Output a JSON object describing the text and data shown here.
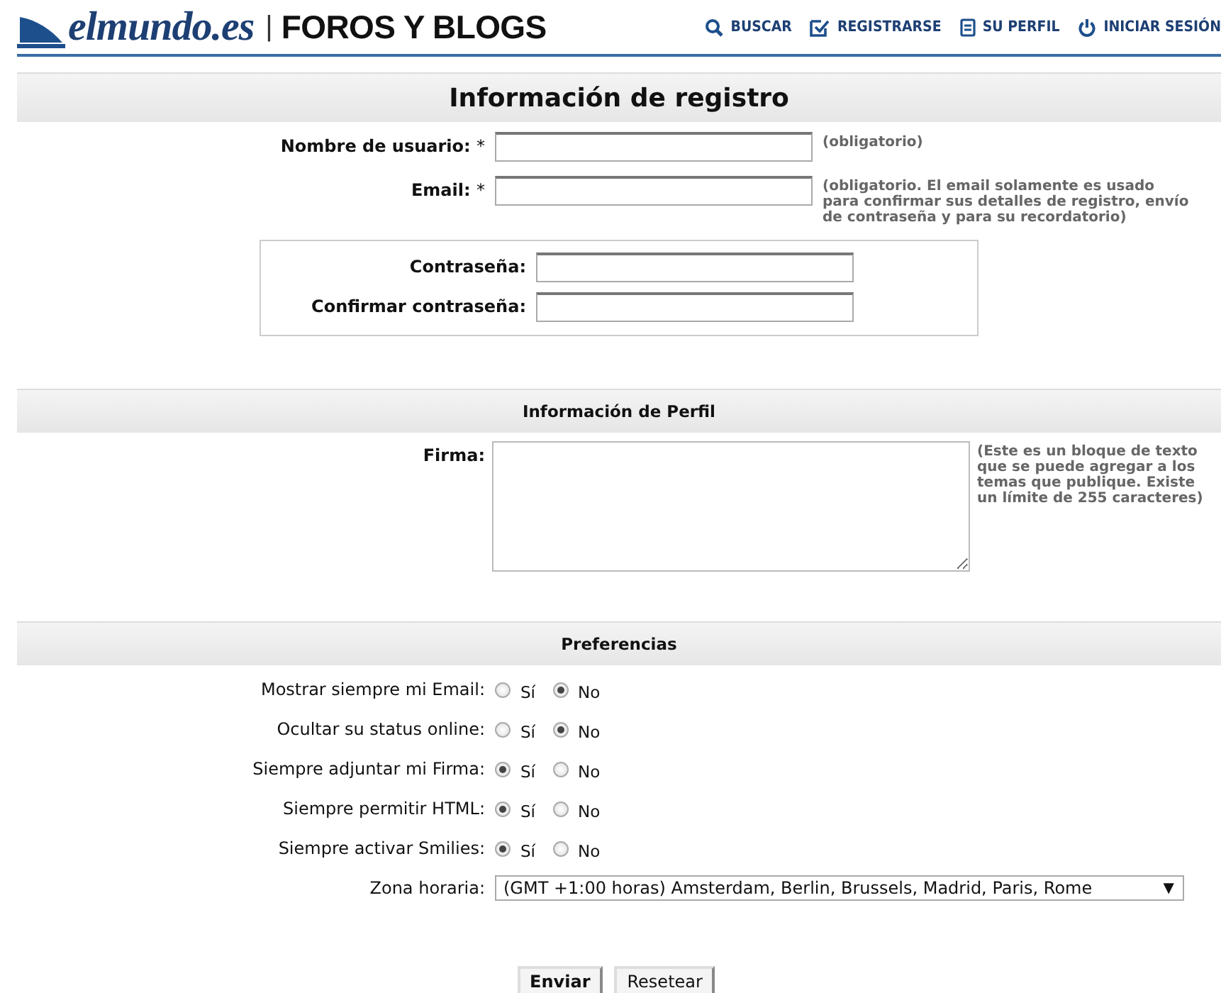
{
  "header": {
    "logo": "elmundo.es",
    "separator": "|",
    "section": "FOROS Y BLOGS",
    "nav": [
      {
        "label": "BUSCAR",
        "kind": "search"
      },
      {
        "label": "REGISTRARSE",
        "kind": "register"
      },
      {
        "label": "SU PERFIL",
        "kind": "profile"
      },
      {
        "label": "INICIAR SESIÓN",
        "kind": "login"
      }
    ]
  },
  "registro": {
    "title": "Información de registro",
    "fields": [
      {
        "label": "Nombre de usuario:",
        "required_mark": "*",
        "hint": "(obligatorio)"
      },
      {
        "label": "Email:",
        "required_mark": "*",
        "hint": "(obligatorio. El email solamente es usado para confirmar sus detalles de registro, envío de contraseña y para su recordatorio)"
      }
    ],
    "password_fields": [
      {
        "label": "Contraseña:"
      },
      {
        "label": "Confirmar contraseña:"
      }
    ]
  },
  "perfil": {
    "title": "Información de Perfil",
    "firma": {
      "label": "Firma:",
      "hint": "(Este es un bloque de texto que se puede agregar a los temas que publique. Existe un límite de 255 caracteres)"
    }
  },
  "preferencias": {
    "title": "Preferencias",
    "options": [
      {
        "label": "Mostrar siempre mi Email:",
        "choices": [
          {
            "label": "Sí",
            "selected": false
          },
          {
            "label": "No",
            "selected": true
          }
        ]
      },
      {
        "label": "Ocultar su status online:",
        "choices": [
          {
            "label": "Sí",
            "selected": false
          },
          {
            "label": "No",
            "selected": true
          }
        ]
      },
      {
        "label": "Siempre adjuntar mi Firma:",
        "choices": [
          {
            "label": "Sí",
            "selected": true
          },
          {
            "label": "No",
            "selected": false
          }
        ]
      },
      {
        "label": "Siempre permitir HTML:",
        "choices": [
          {
            "label": "Sí",
            "selected": true
          },
          {
            "label": "No",
            "selected": false
          }
        ]
      },
      {
        "label": "Siempre activar Smilies:",
        "choices": [
          {
            "label": "Sí",
            "selected": true
          },
          {
            "label": "No",
            "selected": false
          }
        ]
      }
    ],
    "timezone": {
      "label": "Zona horaria:",
      "value": "(GMT +1:00 horas) Amsterdam, Berlin, Brussels, Madrid, Paris, Rome",
      "arrow": "▼"
    }
  },
  "buttons": [
    {
      "label": "Enviar",
      "kind": "primary"
    },
    {
      "label": "Resetear",
      "kind": "default"
    }
  ]
}
